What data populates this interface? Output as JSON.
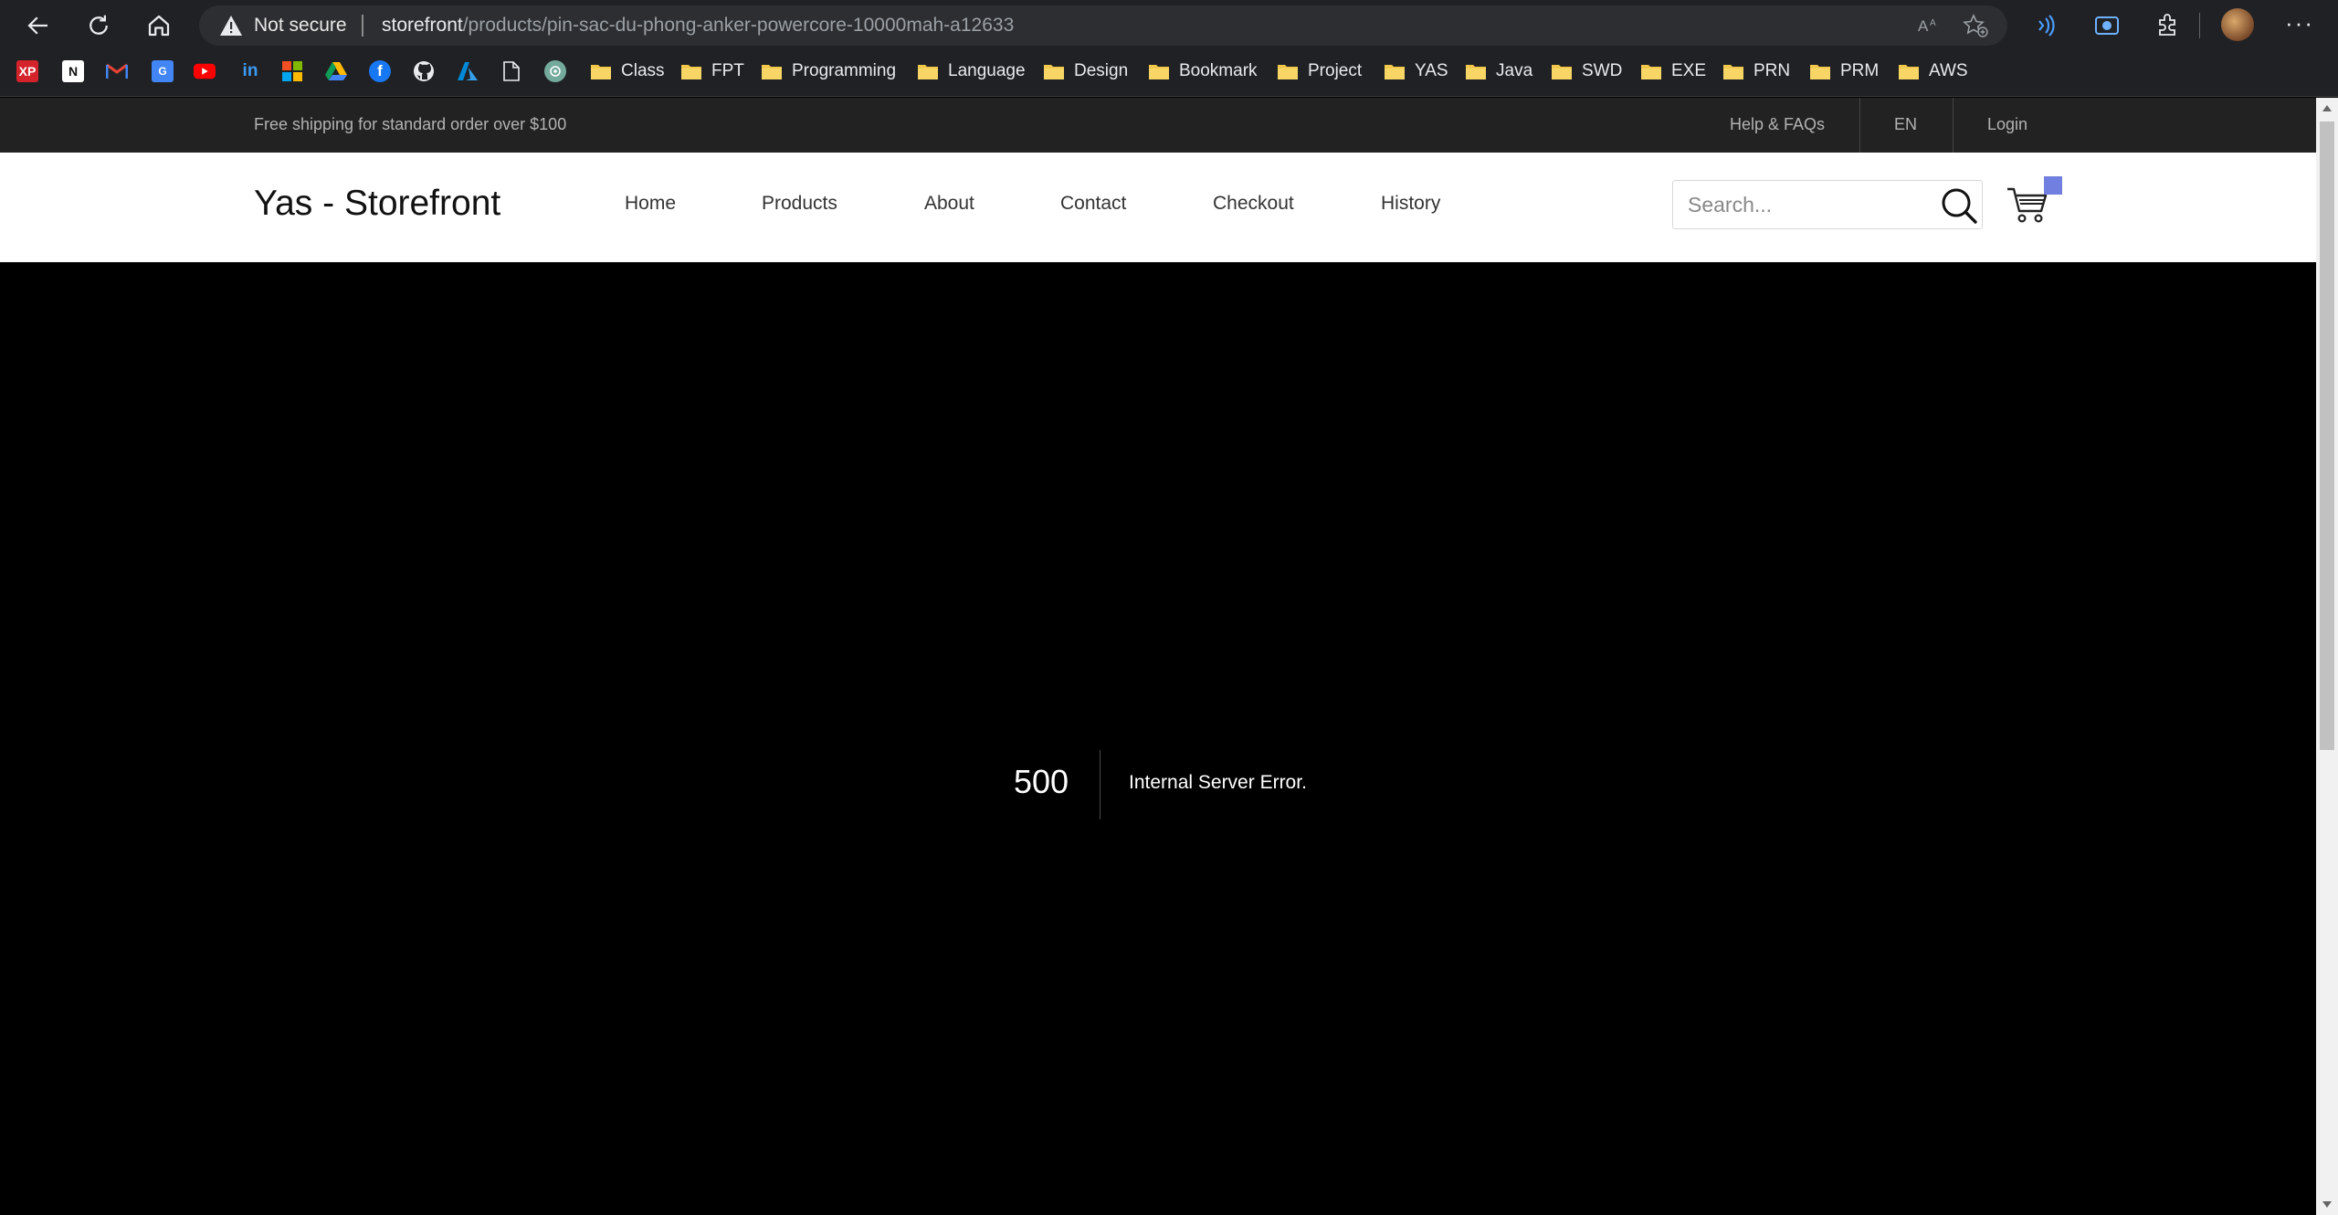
{
  "browser": {
    "security_label": "Not secure",
    "url_host": "storefront",
    "url_path": "/products/pin-sac-du-phong-anker-powercore-10000mah-a12633",
    "bookmark_folders": [
      "Class",
      "FPT",
      "Programming",
      "Language",
      "Design",
      "Bookmark",
      "Project",
      "YAS",
      "Java",
      "SWD",
      "EXE",
      "PRN",
      "PRM",
      "AWS"
    ],
    "bookmark_icons": [
      "xp-icon",
      "notion-icon",
      "gmail-icon",
      "google-translate-icon",
      "youtube-icon",
      "linkedin-icon",
      "microsoft-icon",
      "google-drive-icon",
      "facebook-icon",
      "github-icon",
      "azure-icon",
      "document-icon",
      "chatgpt-icon"
    ]
  },
  "topbar": {
    "shipping_text": "Free shipping for standard order over $100",
    "help_label": "Help & FAQs",
    "language_label": "EN",
    "login_label": "Login"
  },
  "header": {
    "logo": "Yas - Storefront",
    "menu": [
      "Home",
      "Products",
      "About",
      "Contact",
      "Checkout",
      "History"
    ],
    "search_placeholder": "Search...",
    "cart_badge_color": "#717fe0"
  },
  "error": {
    "code": "500",
    "message": "Internal Server Error."
  }
}
